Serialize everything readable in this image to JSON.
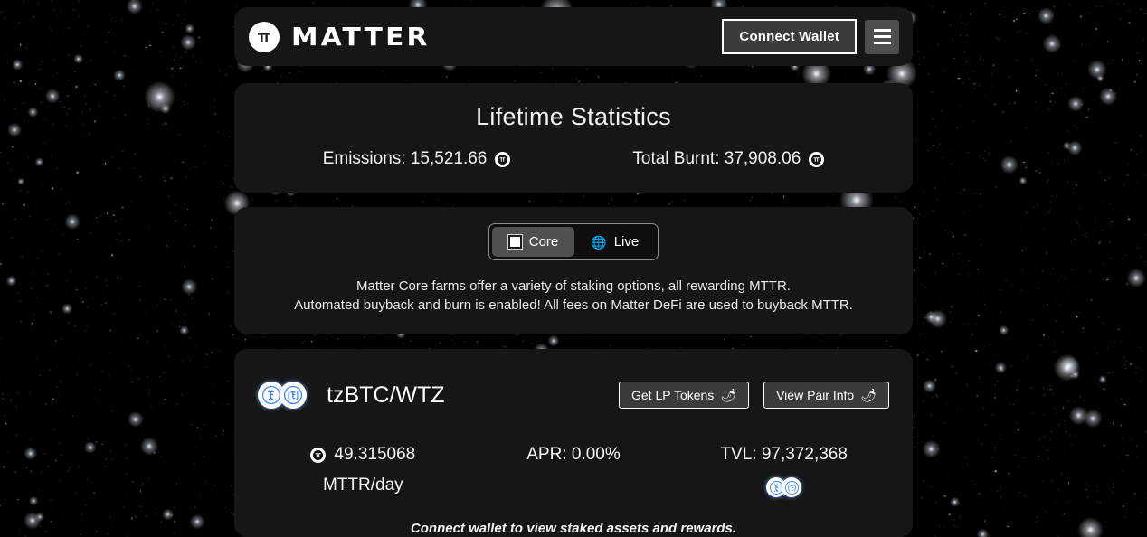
{
  "header": {
    "logo_icon": "matter-logo-icon",
    "brand": "MATTER",
    "connect_label": "Connect Wallet",
    "menu_icon": "hamburger-menu-icon"
  },
  "statistics": {
    "title": "Lifetime Statistics",
    "items": [
      {
        "label": "Emissions: 15,521.66",
        "icon": "mttr-coin-icon"
      },
      {
        "label": "Total Burnt: 37,908.06",
        "icon": "mttr-coin-icon"
      }
    ]
  },
  "tabs": {
    "options": [
      {
        "label": "Core",
        "icon": "square-icon",
        "active": true
      },
      {
        "label": "Live",
        "icon": "globe-icon",
        "active": false
      }
    ],
    "description_line1": "Matter Core farms offer a variety of staking options, all rewarding MTTR.",
    "description_line2": "Automated buyback and burn is enabled! All fees on Matter DeFi are used to buyback MTTR."
  },
  "farm": {
    "pair_name": "tzBTC/WTZ",
    "token_icons": [
      "tzbtc-icon",
      "wtz-icon"
    ],
    "actions": [
      {
        "label": "Get LP Tokens",
        "emoji": "🌶"
      },
      {
        "label": "View Pair Info",
        "emoji": "🌶"
      }
    ],
    "stats": {
      "emission_value": "49.315068",
      "emission_unit": "MTTR/day",
      "emission_icon": "mttr-coin-icon",
      "apr": "APR: 0.00%",
      "tvl": "TVL: 97,372,368"
    },
    "note": "Connect wallet to view staked assets and rewards."
  },
  "colors": {
    "background": "#000000",
    "panel": "#161616",
    "button": "#3b3b3b",
    "menu_button": "#4e4e4e",
    "active_tab": "#505050",
    "token_blue": "#2b7bff",
    "text": "#ffffff"
  }
}
